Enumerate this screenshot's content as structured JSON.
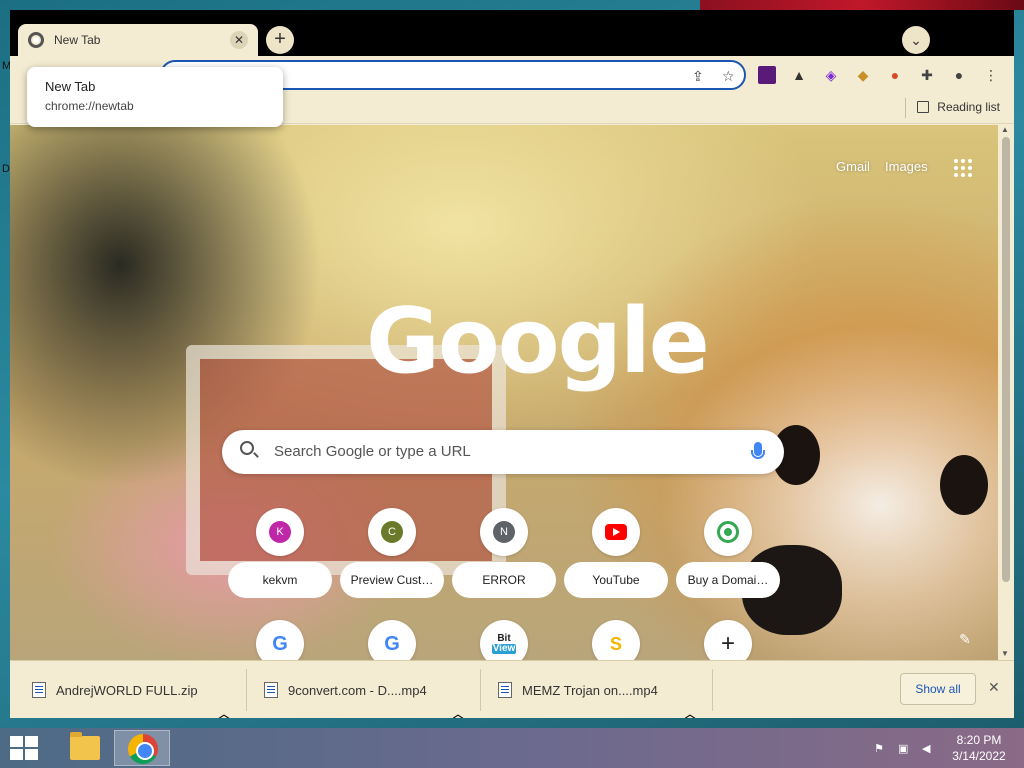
{
  "browser": {
    "tab": {
      "title": "New Tab"
    },
    "popup": {
      "title": "New Tab",
      "url": "chrome://newtab"
    },
    "bookmarks_bar": {
      "reading_list": "Reading list"
    }
  },
  "ntp": {
    "top_links": {
      "gmail": "Gmail",
      "images": "Images"
    },
    "logo": "Google",
    "search": {
      "placeholder": "Search Google or type a URL"
    },
    "shortcuts": [
      {
        "label": "kekvm",
        "icon": "K",
        "color": "#c026a8"
      },
      {
        "label": "Preview Cust…",
        "icon": "C",
        "color": "#6b7a2a"
      },
      {
        "label": "ERROR",
        "icon": "N",
        "color": "#5f6368"
      },
      {
        "label": "YouTube",
        "icon": "youtube-icon",
        "color": "#ff0000"
      },
      {
        "label": "Buy a Domai…",
        "icon": "domain-icon",
        "color": "#34a853"
      }
    ],
    "shortcuts_row2": [
      {
        "icon": "google-icon"
      },
      {
        "icon": "google-icon"
      },
      {
        "icon": "bitview-icon",
        "text_top": "Bit",
        "text_bottom": "View"
      },
      {
        "icon": "s-icon",
        "text": "S"
      },
      {
        "icon": "add-shortcut-icon"
      }
    ]
  },
  "downloads": {
    "items": [
      {
        "name": "AndrejWORLD FULL.zip"
      },
      {
        "name": "9convert.com - D....mp4"
      },
      {
        "name": "MEMZ Trojan on....mp4"
      }
    ],
    "show_all": "Show all"
  },
  "taskbar": {
    "time": "8:20 PM",
    "date": "3/14/2022"
  },
  "desktop": {
    "letter1": "M",
    "letter2": "D"
  }
}
